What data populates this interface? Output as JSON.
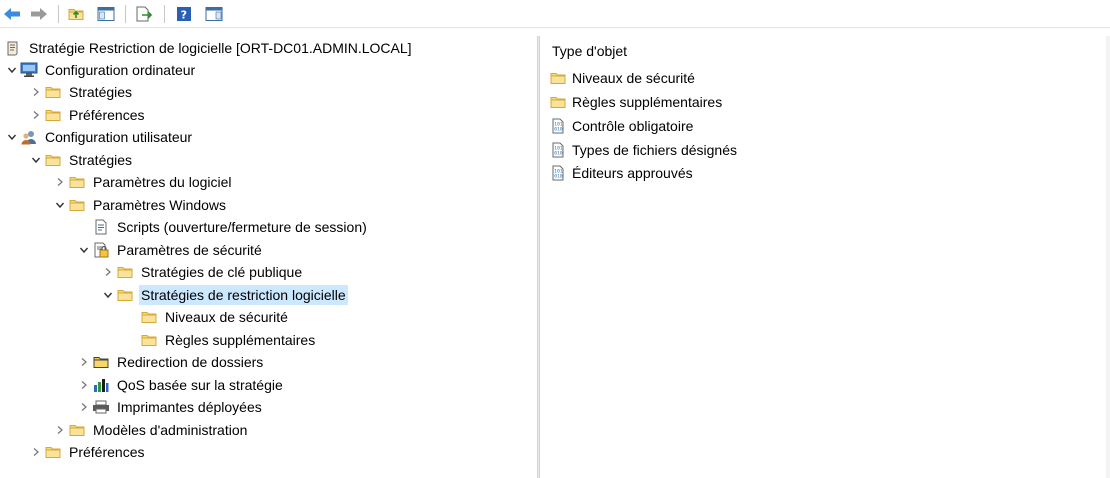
{
  "toolbar": {
    "buttons": [
      {
        "name": "back-button",
        "icon": "arrow-left-icon"
      },
      {
        "name": "forward-button",
        "icon": "arrow-right-icon"
      },
      {
        "name": "up-folder-button",
        "icon": "folder-up-icon"
      },
      {
        "name": "show-hide-tree-button",
        "icon": "console-tree-icon"
      },
      {
        "name": "export-list-button",
        "icon": "export-list-icon"
      },
      {
        "name": "help-button",
        "icon": "help-icon"
      },
      {
        "name": "action-pane-button",
        "icon": "action-pane-icon"
      }
    ]
  },
  "tree": {
    "root": "Stratégie Restriction de logicielle [ORT-DC01.ADMIN.LOCAL]",
    "computer_config": "Configuration ordinateur",
    "computer_strategies": "Stratégies",
    "computer_preferences": "Préférences",
    "user_config": "Configuration utilisateur",
    "user_strategies": "Stratégies",
    "software_settings": "Paramètres du logiciel",
    "windows_settings": "Paramètres Windows",
    "scripts": "Scripts (ouverture/fermeture de session)",
    "security_settings": "Paramètres de sécurité",
    "public_key_policies": "Stratégies de clé publique",
    "software_restriction": "Stratégies de restriction logicielle",
    "security_levels": "Niveaux de sécurité",
    "additional_rules": "Règles supplémentaires",
    "folder_redirection": "Redirection de dossiers",
    "qos": "QoS basée sur la stratégie",
    "printers": "Imprimantes déployées",
    "admin_templates": "Modèles d'administration",
    "user_preferences": "Préférences"
  },
  "content": {
    "column_header": "Type d'objet",
    "items": [
      {
        "label": "Niveaux de sécurité",
        "icon": "folder-icon"
      },
      {
        "label": "Règles supplémentaires",
        "icon": "folder-icon"
      },
      {
        "label": "Contrôle obligatoire",
        "icon": "binary-policy-icon"
      },
      {
        "label": "Types de fichiers désignés",
        "icon": "binary-policy-icon"
      },
      {
        "label": "Éditeurs approuvés",
        "icon": "binary-policy-icon"
      }
    ]
  },
  "colors": {
    "selection": "#cce8ff",
    "folder": "#f8d775",
    "arrow": "#3c8be0"
  }
}
